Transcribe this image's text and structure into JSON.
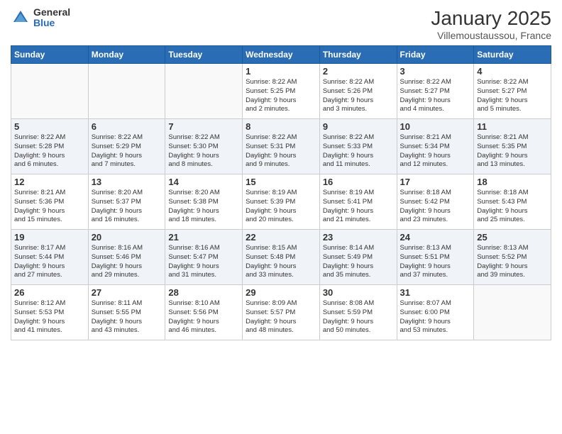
{
  "logo": {
    "general": "General",
    "blue": "Blue"
  },
  "header": {
    "title": "January 2025",
    "location": "Villemoustaussou, France"
  },
  "weekdays": [
    "Sunday",
    "Monday",
    "Tuesday",
    "Wednesday",
    "Thursday",
    "Friday",
    "Saturday"
  ],
  "weeks": [
    [
      {
        "day": "",
        "info": ""
      },
      {
        "day": "",
        "info": ""
      },
      {
        "day": "",
        "info": ""
      },
      {
        "day": "1",
        "info": "Sunrise: 8:22 AM\nSunset: 5:25 PM\nDaylight: 9 hours\nand 2 minutes."
      },
      {
        "day": "2",
        "info": "Sunrise: 8:22 AM\nSunset: 5:26 PM\nDaylight: 9 hours\nand 3 minutes."
      },
      {
        "day": "3",
        "info": "Sunrise: 8:22 AM\nSunset: 5:27 PM\nDaylight: 9 hours\nand 4 minutes."
      },
      {
        "day": "4",
        "info": "Sunrise: 8:22 AM\nSunset: 5:27 PM\nDaylight: 9 hours\nand 5 minutes."
      }
    ],
    [
      {
        "day": "5",
        "info": "Sunrise: 8:22 AM\nSunset: 5:28 PM\nDaylight: 9 hours\nand 6 minutes."
      },
      {
        "day": "6",
        "info": "Sunrise: 8:22 AM\nSunset: 5:29 PM\nDaylight: 9 hours\nand 7 minutes."
      },
      {
        "day": "7",
        "info": "Sunrise: 8:22 AM\nSunset: 5:30 PM\nDaylight: 9 hours\nand 8 minutes."
      },
      {
        "day": "8",
        "info": "Sunrise: 8:22 AM\nSunset: 5:31 PM\nDaylight: 9 hours\nand 9 minutes."
      },
      {
        "day": "9",
        "info": "Sunrise: 8:22 AM\nSunset: 5:33 PM\nDaylight: 9 hours\nand 11 minutes."
      },
      {
        "day": "10",
        "info": "Sunrise: 8:21 AM\nSunset: 5:34 PM\nDaylight: 9 hours\nand 12 minutes."
      },
      {
        "day": "11",
        "info": "Sunrise: 8:21 AM\nSunset: 5:35 PM\nDaylight: 9 hours\nand 13 minutes."
      }
    ],
    [
      {
        "day": "12",
        "info": "Sunrise: 8:21 AM\nSunset: 5:36 PM\nDaylight: 9 hours\nand 15 minutes."
      },
      {
        "day": "13",
        "info": "Sunrise: 8:20 AM\nSunset: 5:37 PM\nDaylight: 9 hours\nand 16 minutes."
      },
      {
        "day": "14",
        "info": "Sunrise: 8:20 AM\nSunset: 5:38 PM\nDaylight: 9 hours\nand 18 minutes."
      },
      {
        "day": "15",
        "info": "Sunrise: 8:19 AM\nSunset: 5:39 PM\nDaylight: 9 hours\nand 20 minutes."
      },
      {
        "day": "16",
        "info": "Sunrise: 8:19 AM\nSunset: 5:41 PM\nDaylight: 9 hours\nand 21 minutes."
      },
      {
        "day": "17",
        "info": "Sunrise: 8:18 AM\nSunset: 5:42 PM\nDaylight: 9 hours\nand 23 minutes."
      },
      {
        "day": "18",
        "info": "Sunrise: 8:18 AM\nSunset: 5:43 PM\nDaylight: 9 hours\nand 25 minutes."
      }
    ],
    [
      {
        "day": "19",
        "info": "Sunrise: 8:17 AM\nSunset: 5:44 PM\nDaylight: 9 hours\nand 27 minutes."
      },
      {
        "day": "20",
        "info": "Sunrise: 8:16 AM\nSunset: 5:46 PM\nDaylight: 9 hours\nand 29 minutes."
      },
      {
        "day": "21",
        "info": "Sunrise: 8:16 AM\nSunset: 5:47 PM\nDaylight: 9 hours\nand 31 minutes."
      },
      {
        "day": "22",
        "info": "Sunrise: 8:15 AM\nSunset: 5:48 PM\nDaylight: 9 hours\nand 33 minutes."
      },
      {
        "day": "23",
        "info": "Sunrise: 8:14 AM\nSunset: 5:49 PM\nDaylight: 9 hours\nand 35 minutes."
      },
      {
        "day": "24",
        "info": "Sunrise: 8:13 AM\nSunset: 5:51 PM\nDaylight: 9 hours\nand 37 minutes."
      },
      {
        "day": "25",
        "info": "Sunrise: 8:13 AM\nSunset: 5:52 PM\nDaylight: 9 hours\nand 39 minutes."
      }
    ],
    [
      {
        "day": "26",
        "info": "Sunrise: 8:12 AM\nSunset: 5:53 PM\nDaylight: 9 hours\nand 41 minutes."
      },
      {
        "day": "27",
        "info": "Sunrise: 8:11 AM\nSunset: 5:55 PM\nDaylight: 9 hours\nand 43 minutes."
      },
      {
        "day": "28",
        "info": "Sunrise: 8:10 AM\nSunset: 5:56 PM\nDaylight: 9 hours\nand 46 minutes."
      },
      {
        "day": "29",
        "info": "Sunrise: 8:09 AM\nSunset: 5:57 PM\nDaylight: 9 hours\nand 48 minutes."
      },
      {
        "day": "30",
        "info": "Sunrise: 8:08 AM\nSunset: 5:59 PM\nDaylight: 9 hours\nand 50 minutes."
      },
      {
        "day": "31",
        "info": "Sunrise: 8:07 AM\nSunset: 6:00 PM\nDaylight: 9 hours\nand 53 minutes."
      },
      {
        "day": "",
        "info": ""
      }
    ]
  ]
}
